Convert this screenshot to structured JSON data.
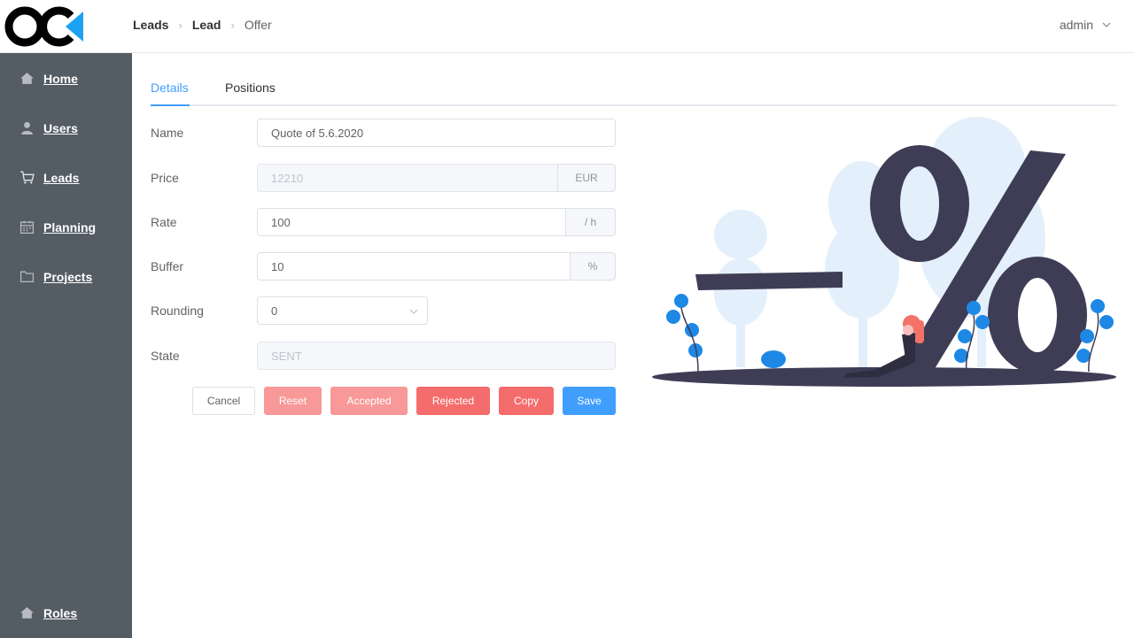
{
  "header": {
    "logo_text": "OC",
    "breadcrumb": [
      "Leads",
      "Lead",
      "Offer"
    ],
    "user_name": "admin"
  },
  "sidebar": {
    "items": [
      {
        "label": "Home",
        "icon": "home-icon"
      },
      {
        "label": "Users",
        "icon": "user-icon"
      },
      {
        "label": "Leads",
        "icon": "cart-icon"
      },
      {
        "label": "Planning",
        "icon": "calendar-icon"
      },
      {
        "label": "Projects",
        "icon": "folder-icon"
      }
    ],
    "bottom_item": {
      "label": "Roles",
      "icon": "home-icon"
    }
  },
  "tabs": [
    {
      "label": "Details",
      "active": true
    },
    {
      "label": "Positions",
      "active": false
    }
  ],
  "form": {
    "name": {
      "label": "Name",
      "value": "Quote of 5.6.2020"
    },
    "price": {
      "label": "Price",
      "value": "12210",
      "unit": "EUR",
      "disabled": true
    },
    "rate": {
      "label": "Rate",
      "value": "100",
      "unit": "/ h"
    },
    "buffer": {
      "label": "Buffer",
      "value": "10",
      "unit": "%"
    },
    "rounding": {
      "label": "Rounding",
      "value": "0"
    },
    "state": {
      "label": "State",
      "value": "SENT",
      "disabled": true
    }
  },
  "buttons": {
    "cancel": "Cancel",
    "reset": "Reset",
    "accepted": "Accepted",
    "rejected": "Rejected",
    "copy": "Copy",
    "save": "Save"
  },
  "colors": {
    "sidebar_bg": "#545c64",
    "accent": "#409eff",
    "danger": "#f56c6c",
    "danger_light": "#f89898",
    "illustration_dark": "#3f3d56"
  }
}
